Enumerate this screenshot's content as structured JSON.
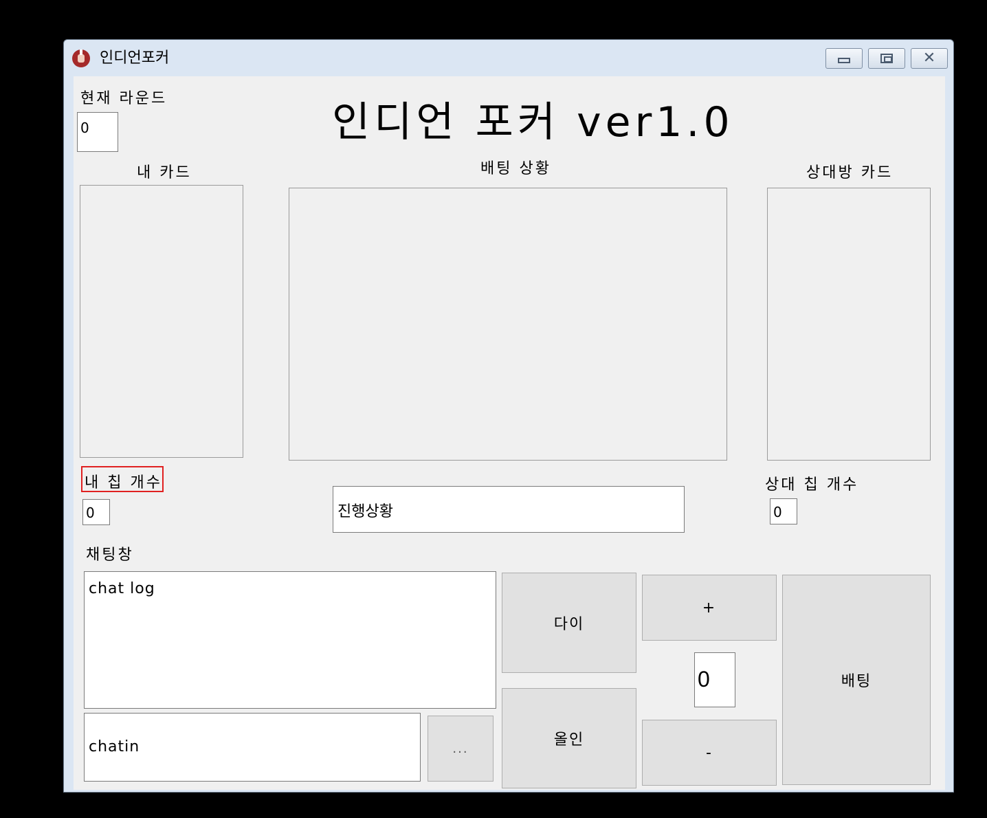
{
  "window": {
    "title": "인디언포커"
  },
  "header": {
    "round_label": "현재 라운드",
    "round_value": "0",
    "title": "인디언 포커 ver1.0"
  },
  "my_card": {
    "label": "내 카드"
  },
  "betting_status": {
    "label": "배팅 상황"
  },
  "opponent_card": {
    "label": "상대방 카드"
  },
  "my_chips": {
    "label": "내 칩 개수",
    "value": "0"
  },
  "progress": {
    "text": "진행상황"
  },
  "opponent_chips": {
    "label": "상대 칩 개수",
    "value": "0"
  },
  "chat": {
    "label": "채팅창",
    "log_text": "chat log",
    "input_text": "chatin",
    "send_label": "..."
  },
  "actions": {
    "die_label": "다이",
    "allin_label": "올인",
    "plus_label": "+",
    "minus_label": "-",
    "bet_amount": "0",
    "bet_label": "배팅"
  },
  "colors": {
    "client_bg": "#f0f0f0",
    "highlight_border": "#e02020",
    "frame": "#dbe6f3"
  }
}
